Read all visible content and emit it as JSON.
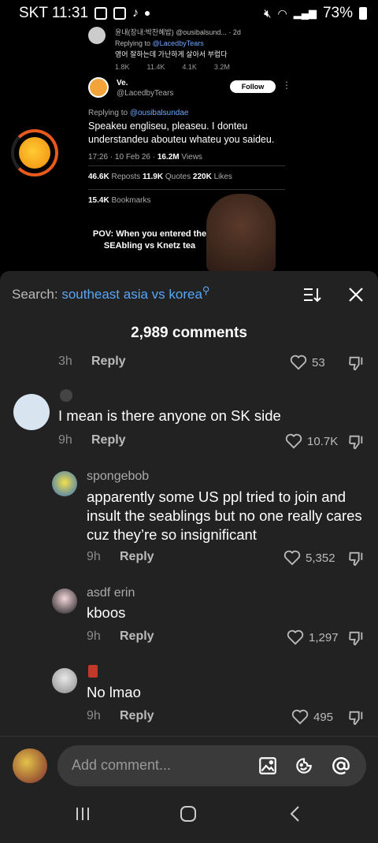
{
  "status_bar": {
    "carrier_time": "SKT 11:31",
    "battery": "73%"
  },
  "video": {
    "top_tweet": {
      "name_line": "윤내(장내:박찬혜밥) @ousibalsund... · 2d",
      "replying_to": "Replying to ",
      "replying_handle": "@LacedbyTears",
      "text": "영어 잘하는데 가난하게 살아서 부럽다",
      "stats": [
        "1.8K",
        "11.4K",
        "4.1K",
        "3.2M"
      ]
    },
    "tweet": {
      "name": "Ve.",
      "handle": "@LacedbyTears",
      "follow": "Follow",
      "replying_to": "Replying to ",
      "replying_handle": "@ousibalsundae",
      "text": "Speakeu engliseu, pleaseu. I donteu understandeu abouteu whateu you saideu.",
      "time": "17:26 · 10 Feb 26 · ",
      "views": "16.2M",
      "views_label": " Views",
      "reposts": "46.6K",
      "reposts_label": " Reposts  ",
      "quotes": "11.9K",
      "quotes_label": " Quotes  ",
      "likes": "220K",
      "likes_label": " Likes",
      "bookmarks": "15.4K",
      "bookmarks_label": " Bookmarks"
    },
    "overlay_caption": "POV: When you entered the SEAbling vs Knetz tea"
  },
  "comments_panel": {
    "search_prefix": "Search: ",
    "search_query": "southeast asia vs korea",
    "count": "2,989 comments",
    "top_row": {
      "time": "3h",
      "reply": "Reply",
      "likes": "53"
    },
    "comments": [
      {
        "user": "",
        "text": "I mean is there anyone on SK side",
        "time": "9h",
        "reply": "Reply",
        "likes": "10.7K"
      },
      {
        "user": "spongebob",
        "text": "apparently some US ppl tried to join and insult the seablings but no one really cares cuz they’re so insignificant",
        "time": "9h",
        "reply": "Reply",
        "likes": "5,352"
      },
      {
        "user": "asdf erin",
        "text": "kboos",
        "time": "9h",
        "reply": "Reply",
        "likes": "1,297"
      },
      {
        "user": "",
        "text": "No lmao",
        "time": "9h",
        "reply": "Reply",
        "likes": "495"
      }
    ],
    "add_comment_placeholder": "Add comment..."
  }
}
